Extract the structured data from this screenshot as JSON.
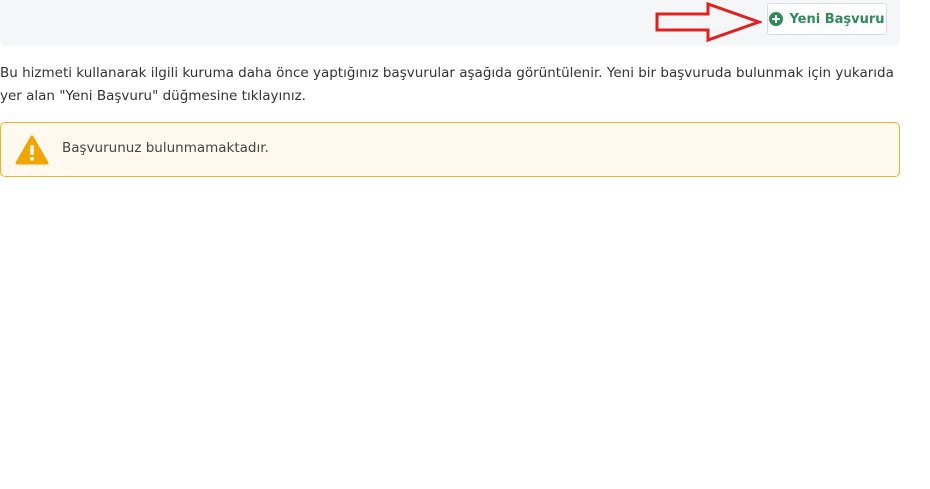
{
  "toolbar": {
    "new_application_label": "Yeni Başvuru"
  },
  "content": {
    "info_line1": "Bu hizmeti kullanarak ilgili kuruma daha önce yaptığınız başvurular aşağıda görüntülenir. Yeni bir başvuruda bulunmak için yukarıda",
    "info_line2": "yer alan \"Yeni Başvuru\" düğmesine tıklayınız."
  },
  "alert": {
    "message": "Başvurunuz bulunmamaktadır."
  },
  "colors": {
    "accent_green": "#2e8b57",
    "warning_orange": "#f0a500",
    "annotation_red": "#e02020"
  }
}
